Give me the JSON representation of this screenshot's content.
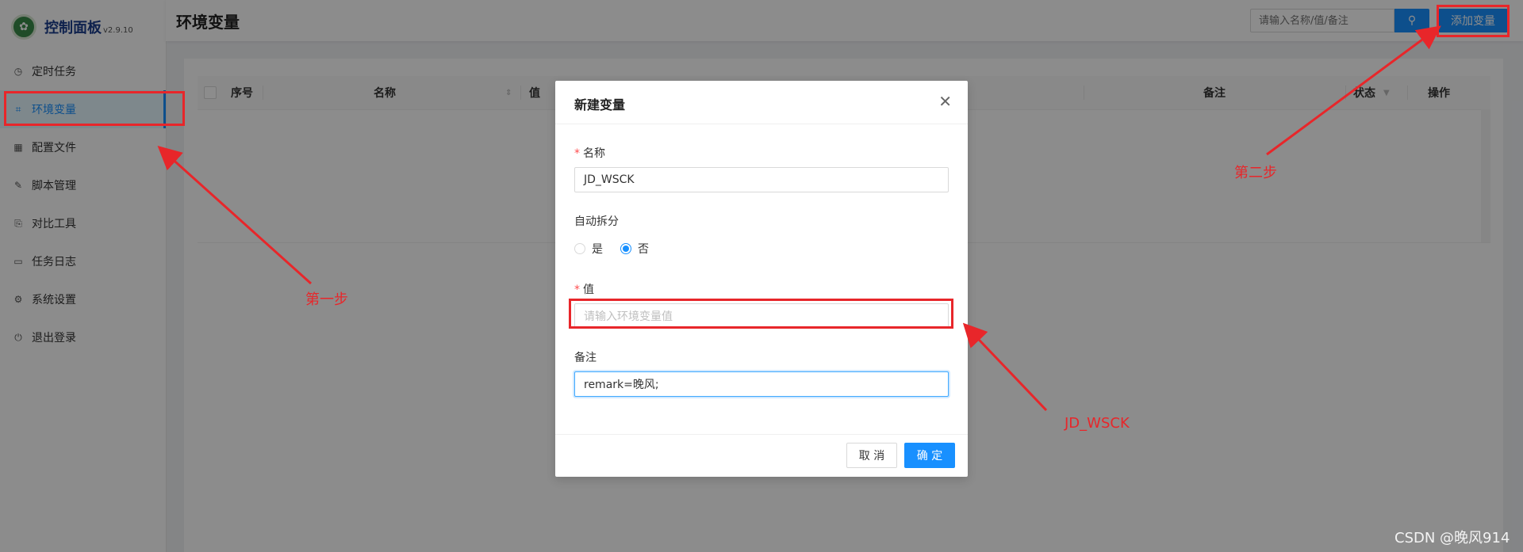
{
  "app": {
    "title": "控制面板",
    "version": "v2.9.10"
  },
  "sidebar": {
    "items": [
      {
        "label": "定时任务",
        "icon": "clock-icon"
      },
      {
        "label": "环境变量",
        "icon": "variable-icon",
        "active": true
      },
      {
        "label": "配置文件",
        "icon": "config-icon"
      },
      {
        "label": "脚本管理",
        "icon": "edit-icon"
      },
      {
        "label": "对比工具",
        "icon": "diff-icon"
      },
      {
        "label": "任务日志",
        "icon": "folder-icon"
      },
      {
        "label": "系统设置",
        "icon": "gear-icon"
      },
      {
        "label": "退出登录",
        "icon": "logout-icon"
      }
    ]
  },
  "header": {
    "title": "环境变量",
    "search_placeholder": "请输入名称/值/备注",
    "add_label": "添加变量"
  },
  "table": {
    "columns": [
      "序号",
      "名称",
      "值",
      "备注",
      "状态",
      "操作"
    ]
  },
  "modal": {
    "title": "新建变量",
    "name_label": "名称",
    "name_value": "JD_WSCK",
    "split_label": "自动拆分",
    "split_options": [
      "是",
      "否"
    ],
    "split_selected": "否",
    "value_label": "值",
    "value_placeholder": "请输入环境变量值",
    "remark_label": "备注",
    "remark_value": "remark=晚风;",
    "cancel_label": "取 消",
    "ok_label": "确 定"
  },
  "annotations": {
    "step1": "第一步",
    "step2": "第二步",
    "hint": "JD_WSCK"
  },
  "watermark": "CSDN @晚风914",
  "colors": {
    "primary": "#1890ff",
    "annotation": "#e8262a"
  }
}
